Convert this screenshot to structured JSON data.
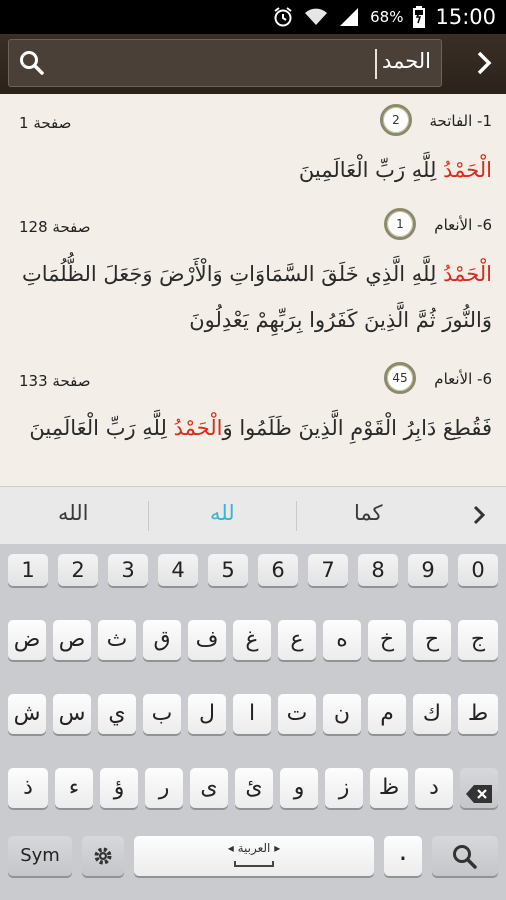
{
  "status_bar": {
    "battery": "68%",
    "time": "15:00"
  },
  "search": {
    "query": "الحمد"
  },
  "results": [
    {
      "sura": "1- الفاتحة",
      "ayah": "2",
      "page": "صفحة 1",
      "lines": [
        {
          "hl": "الْحَمْدُ",
          "rest": " لِلَّهِ رَبِّ الْعَالَمِينَ"
        }
      ]
    },
    {
      "sura": "6- الأنعام",
      "ayah": "1",
      "page": "صفحة 128",
      "lines": [
        {
          "hl": "الْحَمْدُ",
          "rest": " لِلَّهِ الَّذِي خَلَقَ السَّمَاوَاتِ وَالْأَرْضَ وَجَعَلَ الظُّلُمَاتِ"
        },
        {
          "hl": "",
          "rest": "وَالنُّورَ ثُمَّ الَّذِينَ كَفَرُوا بِرَبِّهِمْ يَعْدِلُونَ"
        }
      ]
    },
    {
      "sura": "6- الأنعام",
      "ayah": "45",
      "page": "صفحة 133",
      "lines": [
        {
          "pre": "فَقُطِعَ دَابِرُ الْقَوْمِ الَّذِينَ ظَلَمُوا وَ",
          "hl": "الْحَمْدُ",
          "rest": " لِلَّهِ رَبِّ الْعَالَمِينَ"
        }
      ]
    }
  ],
  "suggestions": {
    "left": "الله",
    "middle": "لله",
    "right": "كما"
  },
  "keyboard": {
    "numbers": [
      "1",
      "2",
      "3",
      "4",
      "5",
      "6",
      "7",
      "8",
      "9",
      "0"
    ],
    "row1": [
      "ض",
      "ص",
      "ث",
      "ق",
      "ف",
      "غ",
      "ع",
      "ه",
      "خ",
      "ح",
      "ج"
    ],
    "row2": [
      "ش",
      "س",
      "ي",
      "ب",
      "ل",
      "ا",
      "ت",
      "ن",
      "م",
      "ك",
      "ط"
    ],
    "row3": [
      "ذ",
      "ء",
      "ؤ",
      "ر",
      "ى",
      "ئ",
      "و",
      "ز",
      "ظ",
      "د"
    ],
    "sym_label": "Sym",
    "space_label": "العربية",
    "period": "."
  },
  "colors": {
    "highlight": "#d92c1c",
    "suggest_active": "#35b6d2"
  }
}
